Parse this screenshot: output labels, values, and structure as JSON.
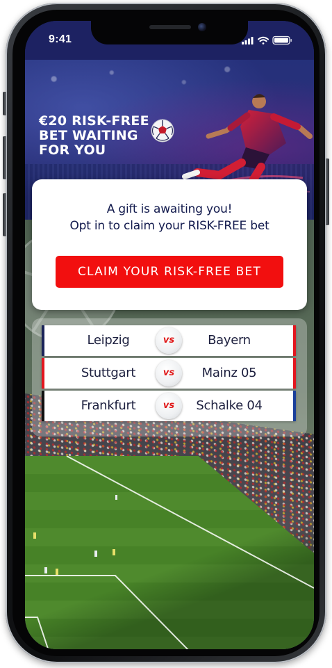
{
  "status_bar": {
    "time": "9:41",
    "signal_icon": "cellular-signal-icon",
    "wifi_icon": "wifi-icon",
    "battery_icon": "battery-icon"
  },
  "hero": {
    "headline_lines": [
      "€20 RISK-FREE",
      "BET WAITING",
      "FOR YOU"
    ],
    "ball_icon": "soccer-ball-icon",
    "player_image": "football-player-kicking"
  },
  "offer": {
    "line1": "A gift is awaiting you!",
    "line2": "Opt in to claim your RISK-FREE bet",
    "claim_button_label": "CLAIM YOUR RISK-FREE BET"
  },
  "matches": [
    {
      "home": "Leipzig",
      "vs": "vs",
      "away": "Bayern",
      "home_color": "#1b2459",
      "away_color": "#e3161f"
    },
    {
      "home": "Stuttgart",
      "vs": "vs",
      "away": "Mainz 05",
      "home_color": "#e3161f",
      "away_color": "#e3161f"
    },
    {
      "home": "Frankfurt",
      "vs": "vs",
      "away": "Schalke 04",
      "home_color": "#111111",
      "away_color": "#1a3f9a"
    }
  ],
  "colors": {
    "accent_red": "#f20f0f",
    "navy_text": "#121a4d",
    "status_bar_bg": "#1d2262"
  }
}
